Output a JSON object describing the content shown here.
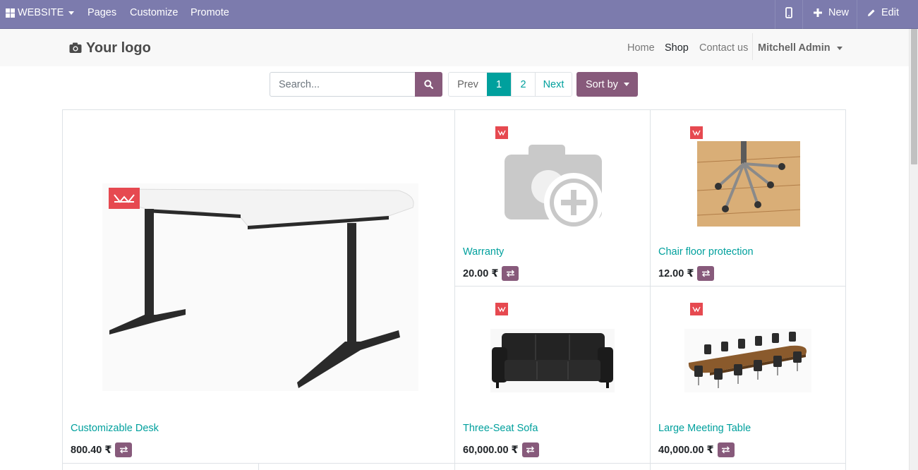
{
  "editor_bar": {
    "website_label": "WEBSITE",
    "pages_label": "Pages",
    "customize_label": "Customize",
    "promote_label": "Promote",
    "new_label": "New",
    "edit_label": "Edit",
    "background_color": "#7c7bad"
  },
  "header": {
    "logo_text": "Your logo",
    "nav": [
      {
        "label": "Home",
        "active": false
      },
      {
        "label": "Shop",
        "active": true
      },
      {
        "label": "Contact us",
        "active": false
      }
    ],
    "user_label": "Mitchell Admin"
  },
  "toolbar": {
    "search_placeholder": "Search...",
    "pager": {
      "prev": "Prev",
      "pages": [
        "1",
        "2"
      ],
      "current": "1",
      "next": "Next"
    },
    "sort_label": "Sort by"
  },
  "products": [
    {
      "name": "Customizable Desk",
      "price": "800.40 ₹",
      "image": "desk"
    },
    {
      "name": "Warranty",
      "price": "20.00 ₹",
      "image": "camera-placeholder"
    },
    {
      "name": "Chair floor protection",
      "price": "12.00 ₹",
      "image": "chair-floor-mat"
    },
    {
      "name": "Three-Seat Sofa",
      "price": "60,000.00 ₹",
      "image": "sofa"
    },
    {
      "name": "Large Meeting Table",
      "price": "40,000.00 ₹",
      "image": "meeting-table"
    }
  ],
  "colors": {
    "primary": "#875a7b",
    "link": "#00a09d",
    "ribbon": "#e64950"
  }
}
